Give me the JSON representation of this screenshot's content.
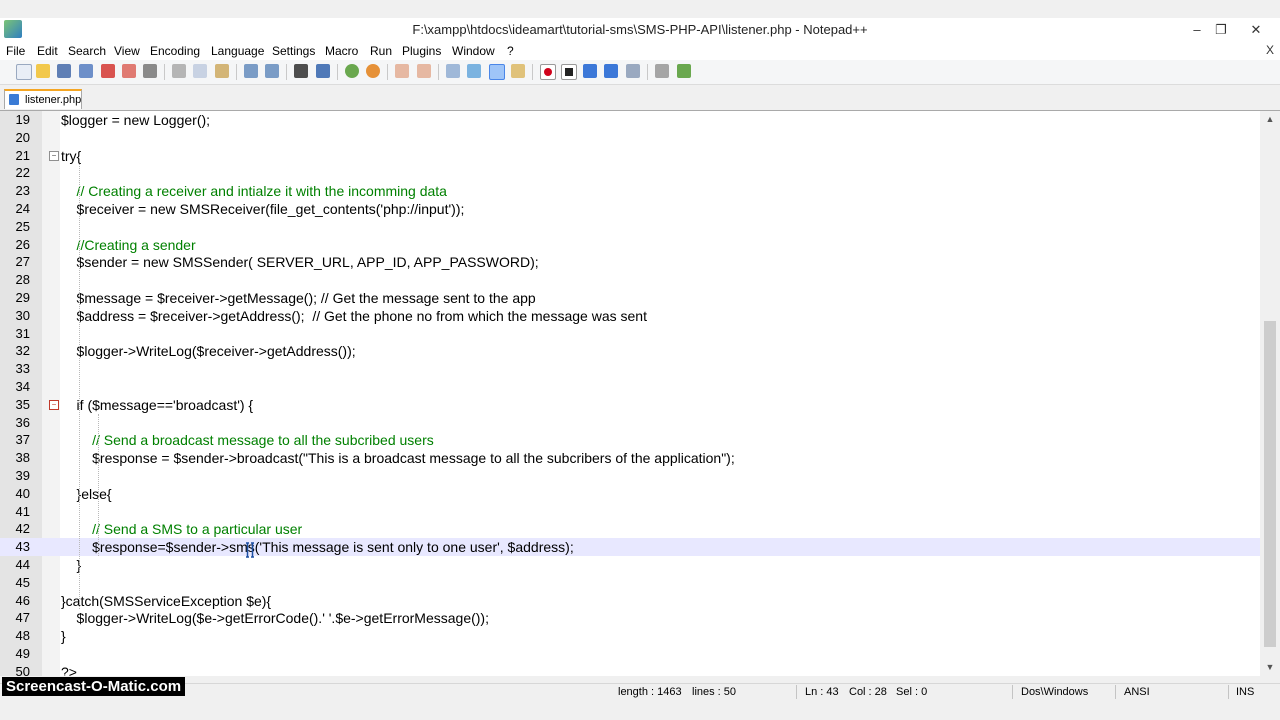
{
  "window": {
    "title": "F:\\xampp\\htdocs\\ideamart\\tutorial-sms\\SMS-PHP-API\\listener.php - Notepad++",
    "controls": [
      "–",
      "❐",
      "✕"
    ]
  },
  "menu": {
    "items": [
      "File",
      "Edit",
      "Search",
      "View",
      "Encoding",
      "Language",
      "Settings",
      "Macro",
      "Run",
      "Plugins",
      "Window",
      "?"
    ],
    "close": "X"
  },
  "tab": {
    "label": "listener.php"
  },
  "editor": {
    "lines": [
      {
        "n": "19",
        "text": "$logger = new Logger();"
      },
      {
        "n": "20",
        "text": ""
      },
      {
        "n": "21",
        "text": "try{"
      },
      {
        "n": "22",
        "text": ""
      },
      {
        "n": "23",
        "text": "    // Creating a receiver and intialze it with the incomming data"
      },
      {
        "n": "24",
        "text": "    $receiver = new SMSReceiver(file_get_contents('php://input'));"
      },
      {
        "n": "25",
        "text": ""
      },
      {
        "n": "26",
        "text": "    //Creating a sender"
      },
      {
        "n": "27",
        "text": "    $sender = new SMSSender( SERVER_URL, APP_ID, APP_PASSWORD);"
      },
      {
        "n": "28",
        "text": ""
      },
      {
        "n": "29",
        "text": "    $message = $receiver->getMessage(); // Get the message sent to the app"
      },
      {
        "n": "30",
        "text": "    $address = $receiver->getAddress();  // Get the phone no from which the message was sent"
      },
      {
        "n": "31",
        "text": ""
      },
      {
        "n": "32",
        "text": "    $logger->WriteLog($receiver->getAddress());"
      },
      {
        "n": "33",
        "text": ""
      },
      {
        "n": "34",
        "text": ""
      },
      {
        "n": "35",
        "text": "    if ($message=='broadcast') {"
      },
      {
        "n": "36",
        "text": ""
      },
      {
        "n": "37",
        "text": "        // Send a broadcast message to all the subcribed users"
      },
      {
        "n": "38",
        "text": "        $response = $sender->broadcast(\"This is a broadcast message to all the subcribers of the application\");"
      },
      {
        "n": "39",
        "text": ""
      },
      {
        "n": "40",
        "text": "    }else{"
      },
      {
        "n": "41",
        "text": ""
      },
      {
        "n": "42",
        "text": "        // Send a SMS to a particular user"
      },
      {
        "n": "43",
        "text": "        $response=$sender->sms('This message is sent only to one user', $address);"
      },
      {
        "n": "44",
        "text": "    }"
      },
      {
        "n": "45",
        "text": ""
      },
      {
        "n": "46",
        "text": "}catch(SMSServiceException $e){"
      },
      {
        "n": "47",
        "text": "    $logger->WriteLog($e->getErrorCode().' '.$e->getErrorMessage());"
      },
      {
        "n": "48",
        "text": "}"
      },
      {
        "n": "49",
        "text": ""
      },
      {
        "n": "50",
        "text": "?>"
      }
    ]
  },
  "status": {
    "length": "length : 1463",
    "lines": "lines : 50",
    "ln": "Ln : 43",
    "col": "Col : 28",
    "sel": "Sel : 0",
    "eol": "Dos\\Windows",
    "encoding": "ANSI",
    "mode": "INS"
  },
  "watermark": "Screencast-O-Matic.com",
  "icons": [
    "app-icon",
    "tab-file-icon",
    "scroll-up-icon",
    "scroll-down-icon",
    "fold-box-icon"
  ]
}
